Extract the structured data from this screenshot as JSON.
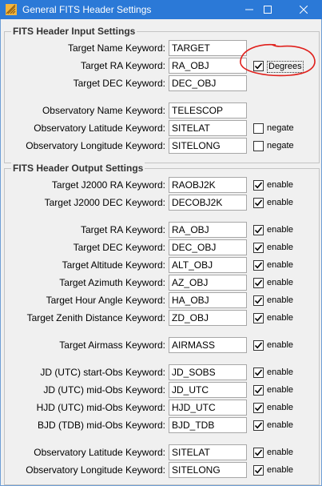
{
  "window": {
    "title": "General FITS Header Settings",
    "icons": {
      "app": "fits-app-icon",
      "minimize": "minimize-icon",
      "maximize": "maximize-icon",
      "close": "close-icon"
    }
  },
  "input_group": {
    "title": "FITS Header Input Settings",
    "rows": [
      {
        "label": "Target Name Keyword:",
        "value": "TARGET"
      },
      {
        "label": "Target RA Keyword:",
        "value": "RA_OBJ",
        "check_label": "Degrees",
        "checked": true
      },
      {
        "label": "Target DEC Keyword:",
        "value": "DEC_OBJ"
      },
      {
        "label": "Observatory Name Keyword:",
        "value": "TELESCOP"
      },
      {
        "label": "Observatory Latitude Keyword:",
        "value": "SITELAT",
        "check_label": "negate",
        "checked": false
      },
      {
        "label": "Observatory Longitude Keyword:",
        "value": "SITELONG",
        "check_label": "negate",
        "checked": false
      }
    ]
  },
  "output_group": {
    "title": "FITS Header Output Settings",
    "rows": [
      {
        "label": "Target J2000 RA Keyword:",
        "value": "RAOBJ2K",
        "check_label": "enable",
        "checked": true
      },
      {
        "label": "Target J2000 DEC Keyword:",
        "value": "DECOBJ2K",
        "check_label": "enable",
        "checked": true
      },
      {
        "label": "Target RA Keyword:",
        "value": "RA_OBJ",
        "check_label": "enable",
        "checked": true
      },
      {
        "label": "Target DEC Keyword:",
        "value": "DEC_OBJ",
        "check_label": "enable",
        "checked": true
      },
      {
        "label": "Target Altitude Keyword:",
        "value": "ALT_OBJ",
        "check_label": "enable",
        "checked": true
      },
      {
        "label": "Target Azimuth Keyword:",
        "value": "AZ_OBJ",
        "check_label": "enable",
        "checked": true
      },
      {
        "label": "Target Hour Angle Keyword:",
        "value": "HA_OBJ",
        "check_label": "enable",
        "checked": true
      },
      {
        "label": "Target Zenith Distance Keyword:",
        "value": "ZD_OBJ",
        "check_label": "enable",
        "checked": true
      },
      {
        "label": "Target Airmass Keyword:",
        "value": "AIRMASS",
        "check_label": "enable",
        "checked": true
      },
      {
        "label": "JD (UTC) start-Obs Keyword:",
        "value": "JD_SOBS",
        "check_label": "enable",
        "checked": true
      },
      {
        "label": "JD (UTC) mid-Obs Keyword:",
        "value": "JD_UTC",
        "check_label": "enable",
        "checked": true
      },
      {
        "label": "HJD (UTC) mid-Obs Keyword:",
        "value": "HJD_UTC",
        "check_label": "enable",
        "checked": true
      },
      {
        "label": "BJD (TDB) mid-Obs Keyword:",
        "value": "BJD_TDB",
        "check_label": "enable",
        "checked": true
      },
      {
        "label": "Observatory Latitude Keyword:",
        "value": "SITELAT",
        "check_label": "enable",
        "checked": true
      },
      {
        "label": "Observatory Longitude Keyword:",
        "value": "SITELONG",
        "check_label": "enable",
        "checked": true
      }
    ]
  },
  "colors": {
    "titlebar": "#2b79d7",
    "annotation": "#e0201c"
  }
}
